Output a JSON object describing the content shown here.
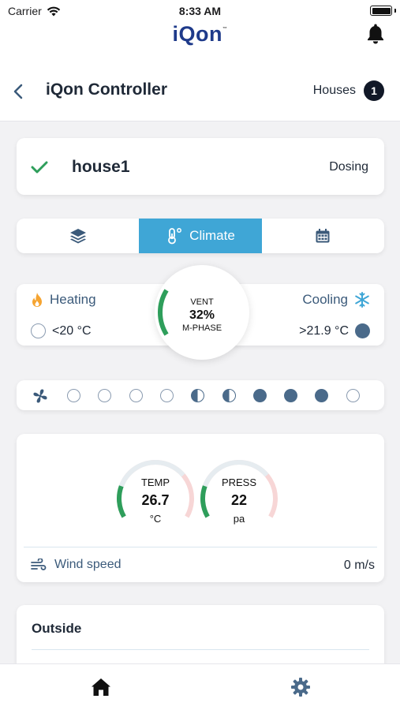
{
  "status_bar": {
    "carrier": "Carrier",
    "time": "8:33 AM"
  },
  "app": {
    "logo": "iQon",
    "logo_tm": "™"
  },
  "header": {
    "title": "iQon Controller",
    "houses_label": "Houses",
    "houses_count": "1"
  },
  "house": {
    "name": "house1",
    "status": "Dosing"
  },
  "tabs": [
    {
      "label": "",
      "icon": "layers-icon",
      "active": false
    },
    {
      "label": "Climate",
      "icon": "thermometer-icon",
      "active": true
    },
    {
      "label": "",
      "icon": "calendar-icon",
      "active": false
    }
  ],
  "climate": {
    "heating_label": "Heating",
    "heating_value": "<20 °C",
    "cooling_label": "Cooling",
    "cooling_value": ">21.9 °C",
    "vent_label": "VENT",
    "vent_value": "32%",
    "vent_percent": 32,
    "vent_phase": "M-PHASE"
  },
  "fan_levels": [
    "empty",
    "empty",
    "empty",
    "empty",
    "half",
    "half",
    "full",
    "full",
    "full",
    "empty"
  ],
  "gauges": [
    {
      "label": "TEMP",
      "value": "26.7",
      "unit": "°C"
    },
    {
      "label": "PRESS",
      "value": "22",
      "unit": "pa"
    }
  ],
  "wind": {
    "label": "Wind speed",
    "value": "0 m/s"
  },
  "outside": {
    "title": "Outside"
  },
  "colors": {
    "accent": "#3fa6d6",
    "green": "#2e9e5b",
    "navy": "#1e3a8a",
    "slate": "#4a6a8a",
    "heat": "#f5a431",
    "cool": "#3fa6d6"
  }
}
